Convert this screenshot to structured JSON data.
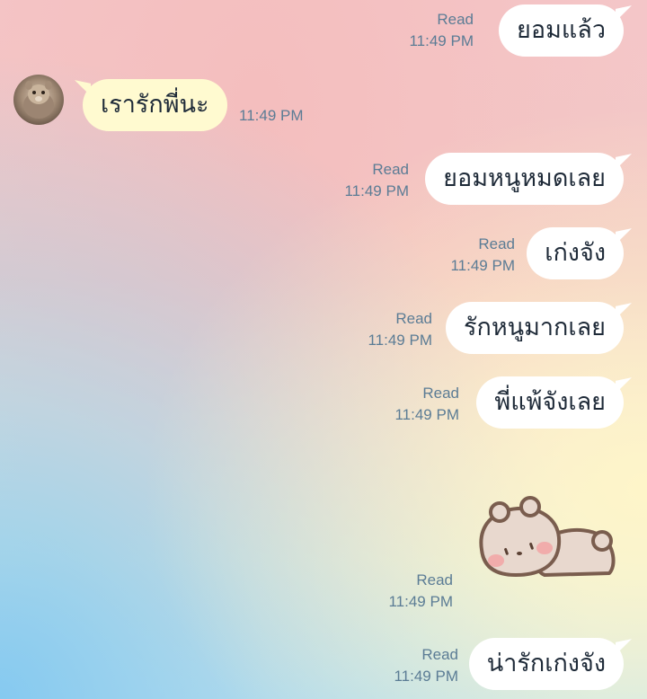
{
  "messages": [
    {
      "id": "m1",
      "direction": "outgoing",
      "text": "ยอมแล้ว",
      "read": "Read",
      "time": "11:49 PM"
    },
    {
      "id": "m2",
      "direction": "incoming",
      "text": "เรารักพี่นะ",
      "time": "11:49 PM"
    },
    {
      "id": "m3",
      "direction": "outgoing",
      "text": "ยอมหนูหมดเลย",
      "read": "Read",
      "time": "11:49 PM"
    },
    {
      "id": "m4",
      "direction": "outgoing",
      "text": "เก่งจัง",
      "read": "Read",
      "time": "11:49 PM"
    },
    {
      "id": "m5",
      "direction": "outgoing",
      "text": "รักหนูมากเลย",
      "read": "Read",
      "time": "11:49 PM"
    },
    {
      "id": "m6",
      "direction": "outgoing",
      "text": "พี่แพ้จังเลย",
      "read": "Read",
      "time": "11:49 PM"
    },
    {
      "id": "m7",
      "direction": "outgoing",
      "type": "sticker",
      "sticker": "sleeping-bear-sticker",
      "read": "Read",
      "time": "11:49 PM"
    },
    {
      "id": "m8",
      "direction": "outgoing",
      "text": "น่ารักเก่งจัง",
      "read": "Read",
      "time": "11:49 PM"
    }
  ],
  "colors": {
    "outgoing_bubble": "#ffffff",
    "incoming_bubble": "#fffad0",
    "meta_text": "#5b7c95",
    "message_text": "#1e2a38"
  },
  "icons": {
    "avatar": "contact-avatar"
  }
}
